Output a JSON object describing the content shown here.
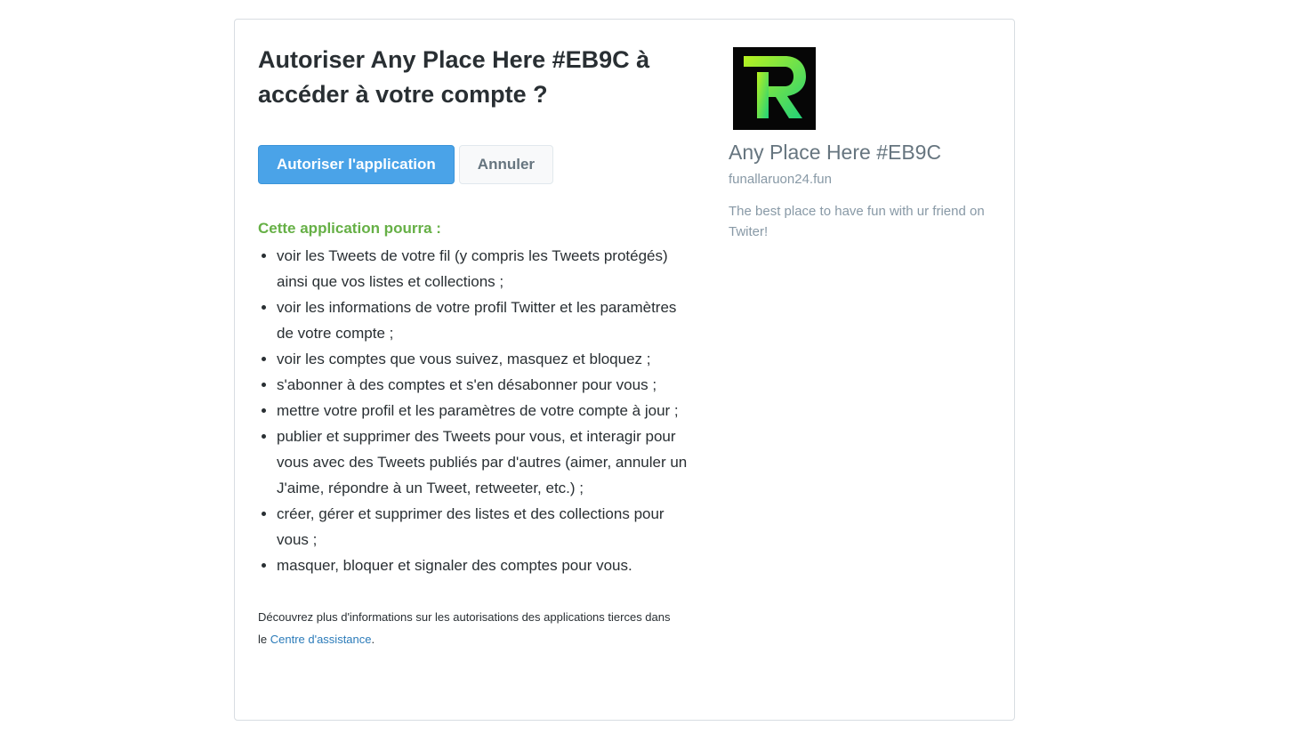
{
  "authorize": {
    "title": "Autoriser Any Place Here #EB9C à accéder à votre compte ?",
    "authorize_button": "Autoriser l'application",
    "cancel_button": "Annuler",
    "permissions_heading": "Cette application pourra :",
    "permissions": [
      "voir les Tweets de votre fil (y compris les Tweets protégés) ainsi que vos listes et collections ;",
      "voir les informations de votre profil Twitter et les paramètres de votre compte ;",
      "voir les comptes que vous suivez, masquez et bloquez ;",
      "s'abonner à des comptes et s'en désabonner pour vous ;",
      "mettre votre profil et les paramètres de votre compte à jour ;",
      "publier et supprimer des Tweets pour vous, et interagir pour vous avec des Tweets publiés par d'autres (aimer, annuler un J'aime, répondre à un Tweet, retweeter, etc.) ;",
      "créer, gérer et supprimer des listes et des collections pour vous ;",
      "masquer, bloquer et signaler des comptes pour vous."
    ],
    "footer_text": "Découvrez plus d'informations sur les autorisations des applications tierces dans le ",
    "footer_link": "Centre d'assistance",
    "footer_end": "."
  },
  "app": {
    "logo_icon": "letter-r-logo-icon",
    "logo_letter": "R",
    "name": "Any Place Here #EB9C",
    "domain": "funallaruon24.fun",
    "description": "The best place to have fun with ur friend on Twiter!"
  },
  "colors": {
    "primary_button": "#4aa3e8",
    "permissions_heading": "#66b046",
    "link": "#2b7bb9",
    "logo_background": "#060606",
    "logo_gradient_start": "#b8f21f",
    "logo_gradient_end": "#1fd07a"
  }
}
